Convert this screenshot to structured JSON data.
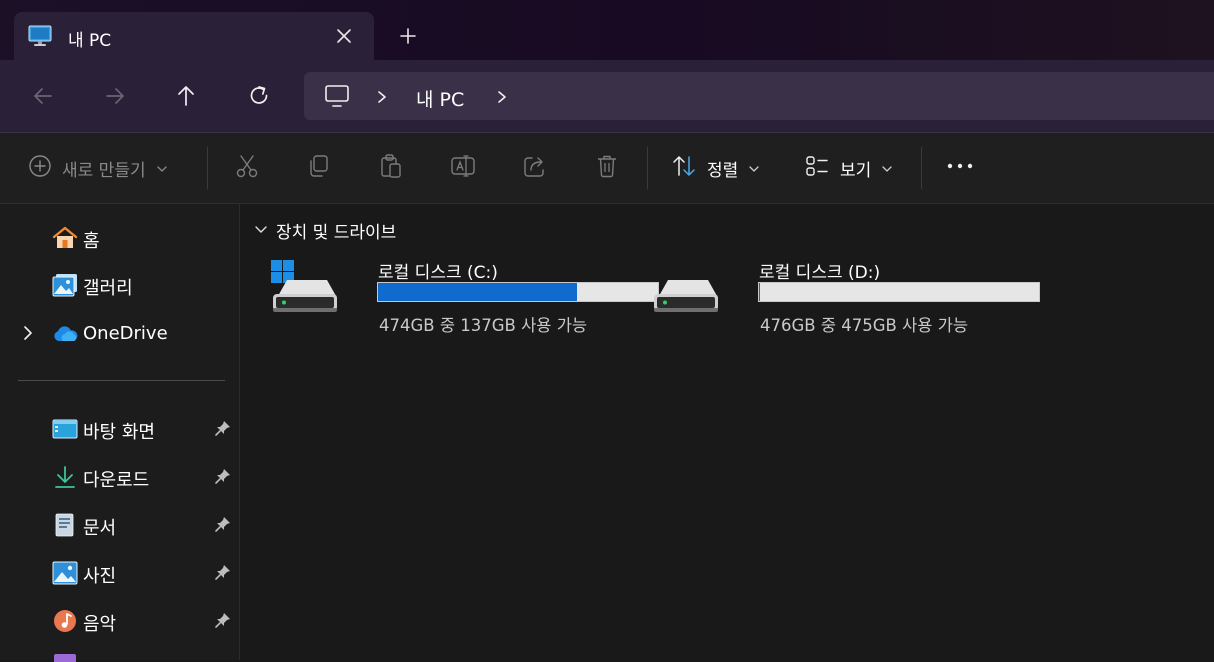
{
  "window": {
    "tab": {
      "title": "내 PC",
      "icon": "pc-monitor-icon"
    }
  },
  "navigation": {
    "address": {
      "segments": [
        "내 PC"
      ]
    }
  },
  "commandbar": {
    "new_label": "새로 만들기",
    "sort_label": "정렬",
    "view_label": "보기"
  },
  "sidebar": {
    "items": [
      {
        "label": "홈",
        "icon": "home-icon"
      },
      {
        "label": "갤러리",
        "icon": "gallery-icon"
      },
      {
        "label": "OneDrive",
        "icon": "onedrive-cloud-icon"
      }
    ],
    "quick_access": [
      {
        "label": "바탕 화면",
        "icon": "desktop-icon",
        "pinned": true
      },
      {
        "label": "다운로드",
        "icon": "download-icon",
        "pinned": true
      },
      {
        "label": "문서",
        "icon": "documents-icon",
        "pinned": true
      },
      {
        "label": "사진",
        "icon": "pictures-icon",
        "pinned": true
      },
      {
        "label": "음악",
        "icon": "music-icon",
        "pinned": true
      }
    ]
  },
  "content": {
    "group_label": "장치 및 드라이브",
    "drives": [
      {
        "name": "로컬 디스크 (C:)",
        "free_text": "474GB 중 137GB 사용 가능",
        "used_fraction": 0.711,
        "bar_color": "#0f6cce",
        "system_drive": true
      },
      {
        "name": "로컬 디스크 (D:)",
        "free_text": "476GB 중 475GB 사용 가능",
        "used_fraction": 0.002,
        "bar_color": "#0f6cce",
        "system_drive": false
      }
    ]
  },
  "colors": {
    "accent": "#0f6cce",
    "background": "#191919"
  }
}
